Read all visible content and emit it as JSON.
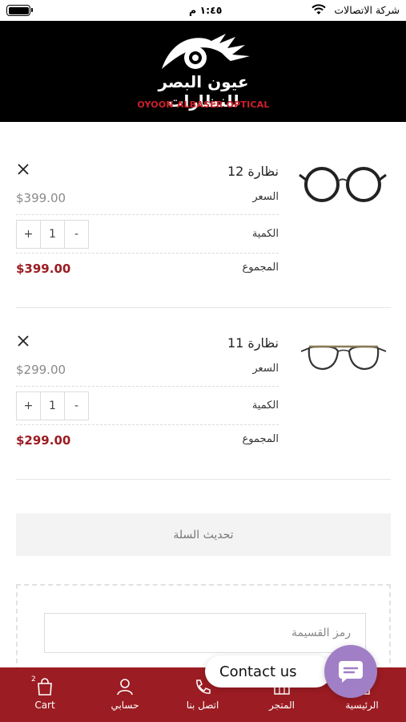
{
  "status_bar": {
    "carrier": "شركة الاتصالات",
    "time": "١:٤٥ م"
  },
  "header": {
    "logo_ar": "عيون البصر للنظارات",
    "logo_en": "OYOON ALBASER OPTICAL"
  },
  "cart": {
    "price_label": "السعر",
    "quantity_label": "الكمية",
    "total_label": "المجموع",
    "items": [
      {
        "name": "نظارة 12",
        "price": "$399.00",
        "quantity": "1",
        "total": "$399.00",
        "thumb": "round-glasses-icon"
      },
      {
        "name": "نظارة 11",
        "price": "$299.00",
        "quantity": "1",
        "total": "$299.00",
        "thumb": "aviator-glasses-icon"
      }
    ],
    "plus": "+",
    "minus": "-"
  },
  "update_cart_label": "تحديث السلة",
  "coupon": {
    "placeholder": "رمز القسيمة"
  },
  "contact": {
    "label": "Contact us"
  },
  "bottom_nav": {
    "cart": "Cart",
    "cart_count": "2",
    "account": "حسابي",
    "contact": "اتصل بنا",
    "shop": "المتجر",
    "home": "الرئيسية"
  },
  "colors": {
    "brand": "#9b1c22",
    "chat": "#a07fc6"
  }
}
